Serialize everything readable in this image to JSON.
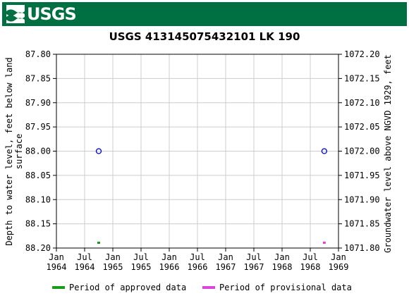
{
  "header": {
    "logo_text": "USGS",
    "logo_icon": "usgs-wave-logo-icon",
    "banner_color": "#006f41"
  },
  "chart_data": {
    "type": "scatter",
    "title": "USGS 413145075432101 LK   190",
    "ylabel_left": "Depth to water level, feet below land surface",
    "ylabel_left_lines": [
      "Depth to water level, feet below land",
      "surface"
    ],
    "ylabel_right": "Groundwater level above NGVD 1929, feet",
    "ylim_left": [
      87.8,
      88.2
    ],
    "left_axis_inverted": true,
    "ylim_right": [
      1071.8,
      1072.2
    ],
    "y_ticks_left": [
      "87.80",
      "87.85",
      "87.90",
      "87.95",
      "88.00",
      "88.05",
      "88.10",
      "88.15",
      "88.20"
    ],
    "y_ticks_right": [
      "1072.20",
      "1072.15",
      "1072.10",
      "1072.05",
      "1072.00",
      "1071.95",
      "1071.90",
      "1071.85",
      "1071.80"
    ],
    "x_ticks": [
      {
        "line1": "Jan",
        "line2": "1964"
      },
      {
        "line1": "Jul",
        "line2": "1964"
      },
      {
        "line1": "Jan",
        "line2": "1965"
      },
      {
        "line1": "Jul",
        "line2": "1965"
      },
      {
        "line1": "Jan",
        "line2": "1966"
      },
      {
        "line1": "Jul",
        "line2": "1966"
      },
      {
        "line1": "Jan",
        "line2": "1967"
      },
      {
        "line1": "Jul",
        "line2": "1967"
      },
      {
        "line1": "Jan",
        "line2": "1968"
      },
      {
        "line1": "Jul",
        "line2": "1968"
      },
      {
        "line1": "Jan",
        "line2": "1969"
      }
    ],
    "grid": true,
    "series": [
      {
        "name": "measurement",
        "marker": "circle",
        "color": "#0000cc",
        "points": [
          {
            "x": "1964-10",
            "y": 88.0
          },
          {
            "x": "1968-10",
            "y": 88.0
          }
        ]
      }
    ],
    "periods": [
      {
        "name": "Period of approved data",
        "color": "#1a9c1a",
        "x": "1964-10"
      },
      {
        "name": "Period of provisional data",
        "color": "#dd44dd",
        "x": "1968-10"
      }
    ],
    "legend_position": "bottom"
  }
}
